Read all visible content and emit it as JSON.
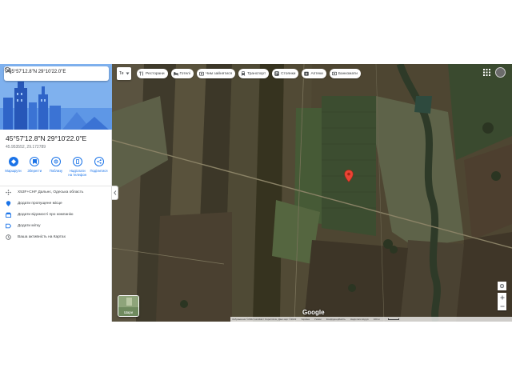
{
  "search": {
    "query": "45°57'12.8\"N 29°10'22.0\"E"
  },
  "place": {
    "title": "45°57'12.8\"N 29°10'22.0\"E",
    "subtitle": "45.953552, 29.172789"
  },
  "actions": [
    {
      "label": "Маршрути",
      "icon": "directions-icon"
    },
    {
      "label": "Зберегти",
      "icon": "save-icon"
    },
    {
      "label": "Поблизу",
      "icon": "nearby-icon"
    },
    {
      "label": "Надіслати на телефон",
      "icon": "send-to-phone-icon"
    },
    {
      "label": "Поділитися",
      "icon": "share-icon"
    }
  ],
  "info_rows": [
    {
      "label": "X53F+CHF Дальнє, Одеська область",
      "icon": "plus-code-icon"
    },
    {
      "label": "Додати пропущене місце",
      "icon": "add-place-icon"
    },
    {
      "label": "Додати відомості про компанію",
      "icon": "business-icon"
    },
    {
      "label": "Додати мітку",
      "icon": "label-icon"
    },
    {
      "label": "Ваша активність на Картах",
      "icon": "history-icon"
    }
  ],
  "layer_select": {
    "value": "Те"
  },
  "chips": [
    {
      "label": "Ресторани",
      "icon": "restaurant-icon"
    },
    {
      "label": "Готелі",
      "icon": "hotel-icon"
    },
    {
      "label": "Чим зайнятися",
      "icon": "attractions-icon"
    },
    {
      "label": "Транспорт",
      "icon": "transit-icon"
    },
    {
      "label": "Стоянки",
      "icon": "parking-icon"
    },
    {
      "label": "Аптеки",
      "icon": "pharmacy-icon"
    },
    {
      "label": "Банкомати",
      "icon": "atm-icon"
    }
  ],
  "layers": {
    "label": "Шари"
  },
  "map": {
    "logo": "Google",
    "footer": [
      "Зображення ©2022 Landsat / Copernicus, Дані карт ©2022",
      "Україна",
      "Умови",
      "Конфіденційність",
      "Надіслати відгук",
      "100 м"
    ]
  },
  "colors": {
    "accent": "#1a73e8",
    "pin": "#ea4335",
    "hero_sky": "#7fb1ee"
  }
}
